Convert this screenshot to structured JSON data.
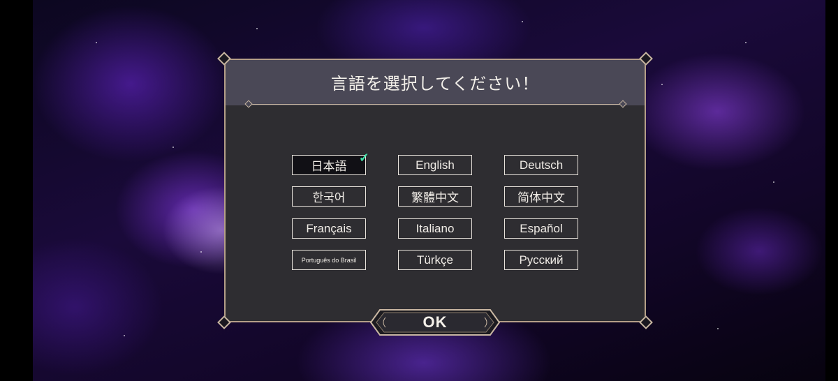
{
  "dialog": {
    "title": "言語を選択してください！",
    "ok_label": "OK"
  },
  "languages": [
    {
      "label": "日本語",
      "selected": true
    },
    {
      "label": "English",
      "selected": false
    },
    {
      "label": "Deutsch",
      "selected": false
    },
    {
      "label": "한국어",
      "selected": false
    },
    {
      "label": "繁體中文",
      "selected": false
    },
    {
      "label": "简体中文",
      "selected": false
    },
    {
      "label": "Français",
      "selected": false
    },
    {
      "label": "Italiano",
      "selected": false
    },
    {
      "label": "Español",
      "selected": false
    },
    {
      "label": "Português do Brasil",
      "selected": false
    },
    {
      "label": "Türkçe",
      "selected": false
    },
    {
      "label": "Русский",
      "selected": false
    }
  ],
  "icons": {
    "selected_check": "check-icon"
  },
  "colors": {
    "panel_bg": "#2e2d31",
    "header_bg": "#4a4856",
    "border": "#b59f88",
    "check": "#3fe0a8"
  }
}
